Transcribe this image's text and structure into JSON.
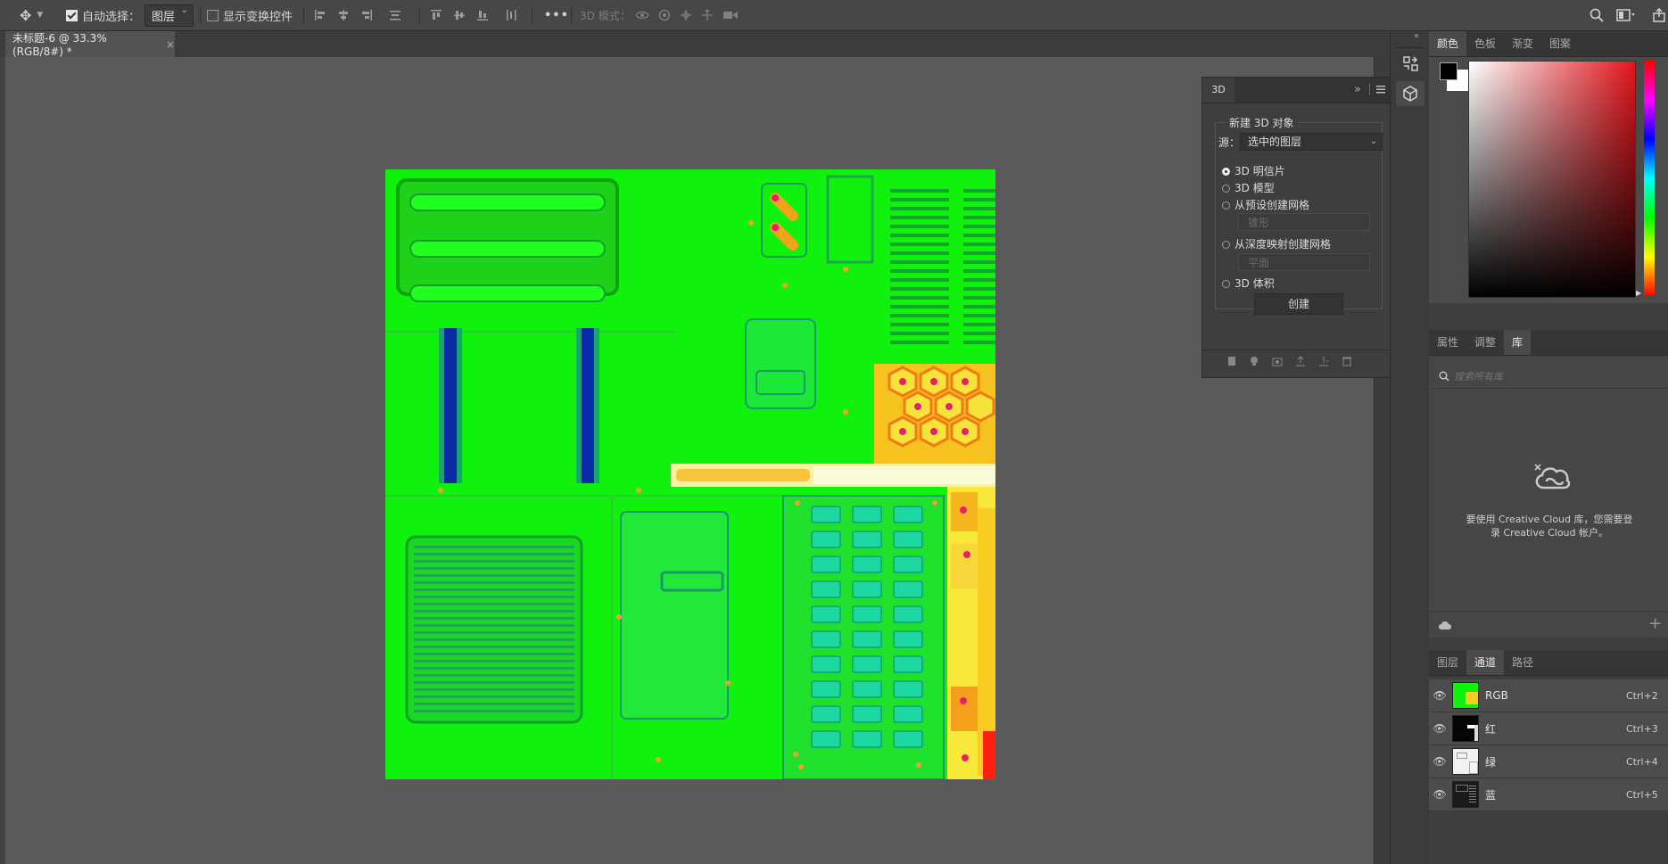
{
  "options_bar": {
    "move_tool_icon": "move-icon",
    "auto_select_label": "自动选择：",
    "auto_select_checked": true,
    "auto_select_target": "图层",
    "show_transform_label": "显示变换控件",
    "show_transform_checked": false,
    "more_label": "•••",
    "mode_3d_label": "3D 模式：",
    "icons": [
      "align-left-icon",
      "align-hcenter-icon",
      "align-right-icon",
      "distribute-vertical-icon",
      "align-top-icon",
      "align-vcenter-icon",
      "align-bottom-icon",
      "distribute-horizontal-icon",
      "orbit-3d-icon",
      "roll-3d-icon",
      "pan-3d-icon",
      "slide-3d-icon",
      "scale-3d-icon",
      "search-icon",
      "workspace-icon",
      "share-icon"
    ]
  },
  "document_tab": {
    "title": "未标题-6 @ 33.3%(RGB/8#) *",
    "close_glyph": "×"
  },
  "panel_3d": {
    "tab_label": "3D",
    "collapse_glyph": "»",
    "group_title": "新建 3D 对象",
    "source_label": "源：",
    "source_value": "选中的图层",
    "options": [
      {
        "label": "3D 明信片",
        "selected": true
      },
      {
        "label": "3D 模型",
        "selected": false
      },
      {
        "label": "从预设创建网格",
        "selected": false
      },
      {
        "label": "从深度映射创建网格",
        "selected": false
      },
      {
        "label": "3D 体积",
        "selected": false
      }
    ],
    "preset_mesh_value": "锥形",
    "depth_map_value": "平面",
    "create_button": "创建"
  },
  "color_panel": {
    "tabs": [
      "颜色",
      "色板",
      "渐变",
      "图案"
    ],
    "active_tab": "颜色",
    "foreground": "#000000",
    "background": "#ffffff",
    "hue_color": "#e3161c"
  },
  "library_panel": {
    "tabs": [
      "属性",
      "调整",
      "库"
    ],
    "active_tab": "库",
    "search_placeholder": "搜索所有库",
    "message": "要使用 Creative Cloud 库，您需要登录 Creative Cloud 帐户。"
  },
  "channels_panel": {
    "tabs": [
      "图层",
      "通道",
      "路径"
    ],
    "active_tab": "通道",
    "channels": [
      {
        "name": "RGB",
        "shortcut": "Ctrl+2"
      },
      {
        "name": "红",
        "shortcut": "Ctrl+3"
      },
      {
        "name": "绿",
        "shortcut": "Ctrl+4"
      },
      {
        "name": "蓝",
        "shortcut": "Ctrl+5"
      }
    ]
  }
}
